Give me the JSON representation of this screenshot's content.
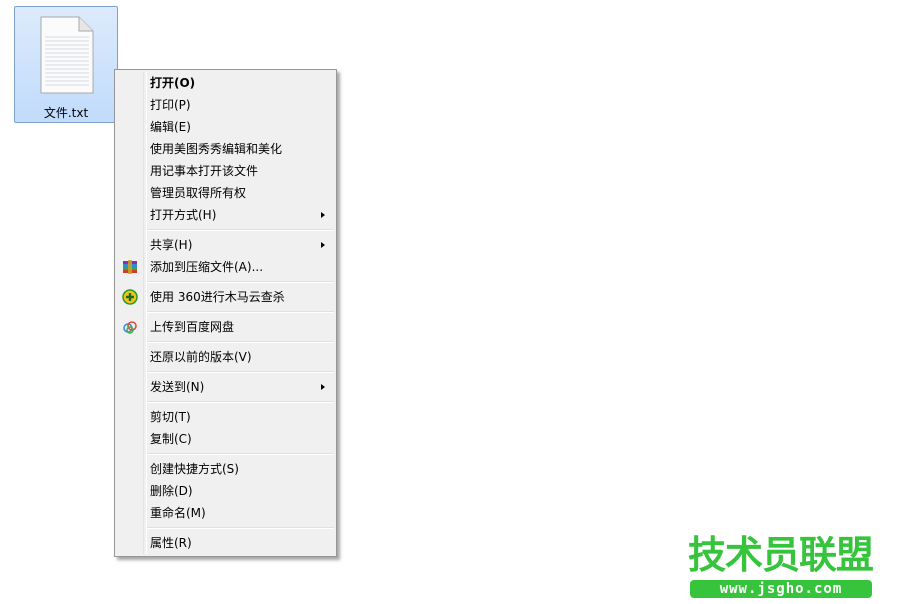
{
  "desktop": {
    "file": {
      "name": "文件.txt",
      "icon": "text-file-icon"
    }
  },
  "context_menu": {
    "groups": [
      [
        {
          "label": "打开(O)",
          "bold": true
        },
        {
          "label": "打印(P)"
        },
        {
          "label": "编辑(E)"
        },
        {
          "label": "使用美图秀秀编辑和美化"
        },
        {
          "label": "用记事本打开该文件"
        },
        {
          "label": "管理员取得所有权"
        },
        {
          "label": "打开方式(H)",
          "submenu": true
        }
      ],
      [
        {
          "label": "共享(H)",
          "submenu": true
        },
        {
          "label": "添加到压缩文件(A)...",
          "icon": "winrar-icon"
        }
      ],
      [
        {
          "label": "使用 360进行木马云查杀",
          "icon": "360-security-icon"
        }
      ],
      [
        {
          "label": "上传到百度网盘",
          "icon": "baidu-netdisk-icon"
        }
      ],
      [
        {
          "label": "还原以前的版本(V)"
        }
      ],
      [
        {
          "label": "发送到(N)",
          "submenu": true
        }
      ],
      [
        {
          "label": "剪切(T)"
        },
        {
          "label": "复制(C)"
        }
      ],
      [
        {
          "label": "创建快捷方式(S)"
        },
        {
          "label": "删除(D)"
        },
        {
          "label": "重命名(M)"
        }
      ],
      [
        {
          "label": "属性(R)"
        }
      ]
    ]
  },
  "watermark": {
    "title": "技术员联盟",
    "url": "www.jsgho.com",
    "color": "#36c43c"
  }
}
